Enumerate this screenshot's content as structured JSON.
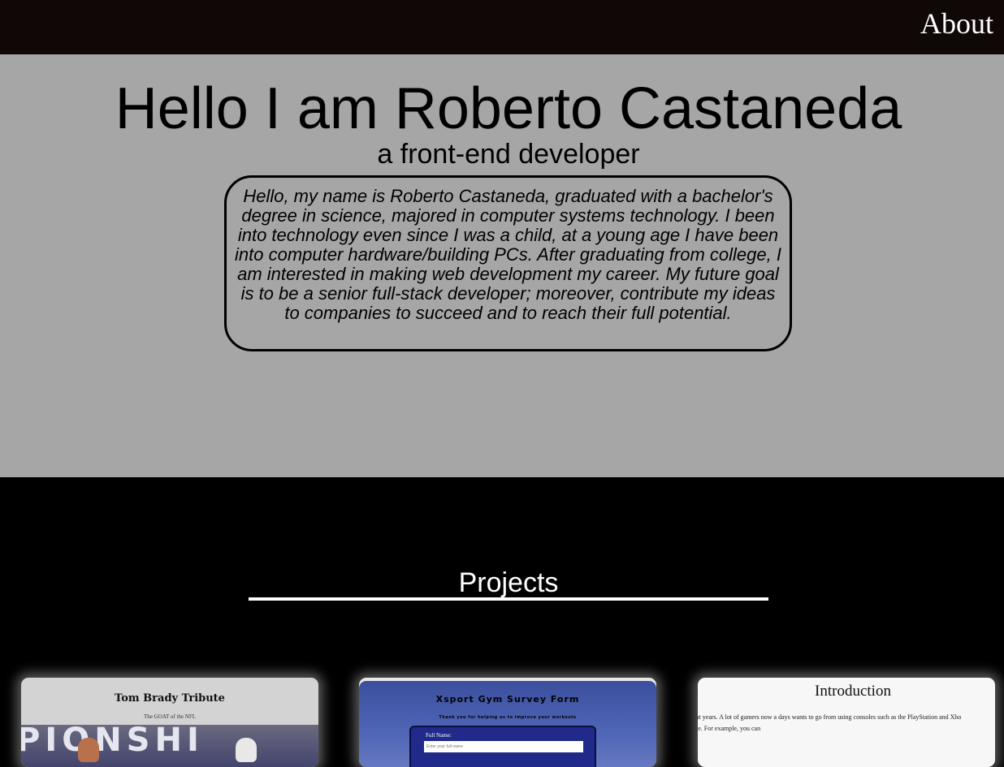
{
  "nav": {
    "about_label": "About"
  },
  "hero": {
    "title": "Hello I am Roberto Castaneda",
    "subtitle": "a front-end developer",
    "bio": "Hello, my name is Roberto Castaneda, graduated with a bachelor's degree in science, majored in computer systems technology. I been into technology even since I was a child, at a young age I have been into computer hardware/building PCs. After graduating from college, I am interested in making web development my career. My future goal is to be a senior full-stack developer; moreover, contribute my ideas to companies to succeed and to reach their full potential."
  },
  "projects": {
    "heading": "Projects",
    "cards": [
      {
        "title": "Tom Brady Tribute",
        "subtitle": "The GOAT of the NFL",
        "banner_text": "PIONSHI"
      },
      {
        "title": "Xsport Gym Survey Form",
        "subtitle": "Thank you for helping us to improve your workouts",
        "field_label": "Full Name:",
        "field_placeholder": "Enter your full name"
      },
      {
        "title": "Introduction",
        "text_line1": "ent years. A lot of gamers now a days wants to go from using consoles such as the PlayStation and Xbo",
        "text_line2": "ble. For example, you can"
      }
    ]
  },
  "colors": {
    "topbar": "#100707",
    "hero_bg": "#a6a6a6",
    "page_bg": "#000000",
    "accent_text": "#ffffff"
  }
}
